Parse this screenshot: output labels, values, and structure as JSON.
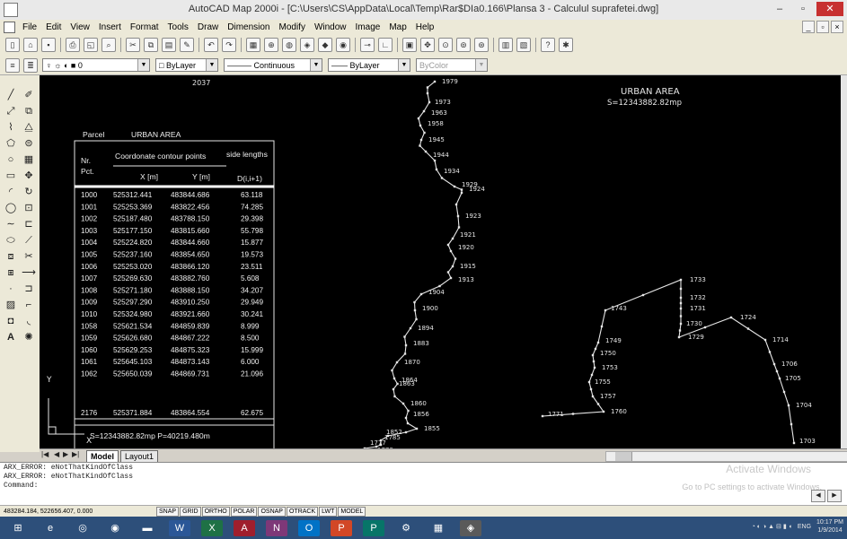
{
  "window": {
    "title": "AutoCAD Map 2000i - [C:\\Users\\CS\\AppData\\Local\\Temp\\Rar$DIa0.166\\Plansa 3 - Calculul suprafetei.dwg]",
    "minimize": "–",
    "maximize": "▫",
    "close": "✕"
  },
  "menu": [
    "File",
    "Edit",
    "View",
    "Insert",
    "Format",
    "Tools",
    "Draw",
    "Dimension",
    "Modify",
    "Window",
    "Image",
    "Map",
    "Help"
  ],
  "layers": {
    "layer_value": "0",
    "color_value": "ByLayer",
    "linetype_value": "Continuous",
    "lineweight_value": "ByLayer",
    "plotstyle_value": "ByColor"
  },
  "drawing": {
    "top_label": "2037",
    "urban_title": "URBAN AREA",
    "urban_area": "S=12343882.82mp",
    "parcel_label": "Parcel",
    "parcel_value": "URBAN AREA",
    "table": {
      "nr_header": "Nr.",
      "pct_header": "Pct.",
      "coord_header": "Coordonate contour points",
      "side_header": "side lengths",
      "x_header": "X [m]",
      "y_header": "Y [m]",
      "d_header": "D(i,i+1)",
      "rows": [
        [
          "1000",
          "525312.441",
          "483844.686",
          "63.118"
        ],
        [
          "1001",
          "525253.369",
          "483822.456",
          "74.285"
        ],
        [
          "1002",
          "525187.480",
          "483788.150",
          "29.398"
        ],
        [
          "1003",
          "525177.150",
          "483815.660",
          "55.798"
        ],
        [
          "1004",
          "525224.820",
          "483844.660",
          "15.877"
        ],
        [
          "1005",
          "525237.160",
          "483854.650",
          "19.573"
        ],
        [
          "1006",
          "525253.020",
          "483866.120",
          "23.511"
        ],
        [
          "1007",
          "525269.630",
          "483882.760",
          "5.608"
        ],
        [
          "1008",
          "525271.180",
          "483888.150",
          "34.207"
        ],
        [
          "1009",
          "525297.290",
          "483910.250",
          "29.949"
        ],
        [
          "1010",
          "525324.980",
          "483921.660",
          "30.241"
        ],
        [
          "1058",
          "525621.534",
          "484859.839",
          "8.999"
        ],
        [
          "1059",
          "525626.680",
          "484867.222",
          "8.500"
        ],
        [
          "1060",
          "525629.253",
          "484875.323",
          "15.999"
        ],
        [
          "1061",
          "525645.103",
          "484873.143",
          "6.000"
        ],
        [
          "1062",
          "525650.039",
          "484869.731",
          "21.096"
        ]
      ],
      "last_row": [
        "2176",
        "525371.884",
        "483864.554",
        "62.675"
      ],
      "summary": "S=12343882.82mp  P=40219.480m"
    },
    "ucs_y": "Y",
    "ucs_x": "X",
    "left_points": [
      "1979",
      "1973",
      "1963",
      "1958",
      "1945",
      "1944",
      "1934",
      "1929",
      "1924",
      "1923",
      "1921",
      "1920",
      "1915",
      "1913",
      "1904",
      "1900",
      "1894",
      "1883",
      "1870",
      "1864",
      "1863",
      "1860",
      "1856",
      "1855",
      "1852",
      "1785",
      "1777",
      "1778"
    ],
    "right_points": [
      "1733",
      "1732",
      "1731",
      "1730",
      "1729",
      "1724",
      "1743",
      "1749",
      "1750",
      "1714",
      "1753",
      "1755",
      "1706",
      "1705",
      "1757",
      "1760",
      "1771",
      "1704",
      "1703"
    ]
  },
  "layout_tabs": {
    "model": "Model",
    "layout1": "Layout1"
  },
  "command": {
    "line1": "ARX_ERROR:  eNotThatKindOfClass",
    "line2": "ARX_ERROR:  eNotThatKindOfClass",
    "line3": "Command:",
    "watermark_title": "Activate Windows",
    "watermark_sub": "Go to PC settings to activate Windows."
  },
  "status": {
    "coords": "483284.184, 522656.407, 0.000",
    "toggles": [
      "SNAP",
      "GRID",
      "ORTHO",
      "POLAR",
      "OSNAP",
      "OTRACK",
      "LWT",
      "MODEL"
    ]
  },
  "taskbar": {
    "lang": "ENG",
    "time": "10:17 PM",
    "date": "1/9/2014"
  },
  "colors": {
    "canvas": "#000000",
    "taskbar": "#2d4f7a",
    "line": "#e6e6e6"
  }
}
